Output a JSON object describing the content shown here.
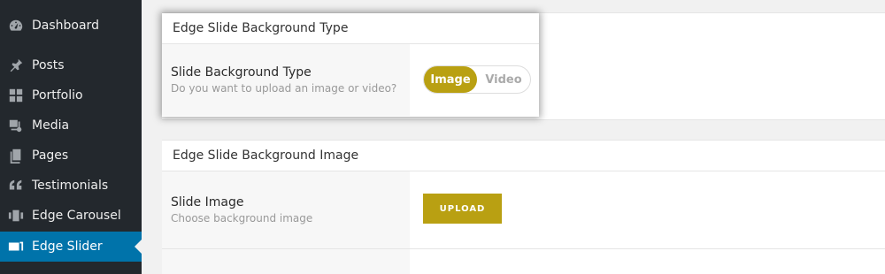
{
  "sidebar": {
    "items": [
      {
        "label": "Dashboard",
        "icon": "dashboard-icon"
      },
      {
        "label": "Posts",
        "icon": "pin-icon"
      },
      {
        "label": "Portfolio",
        "icon": "grid-icon"
      },
      {
        "label": "Media",
        "icon": "media-icon"
      },
      {
        "label": "Pages",
        "icon": "pages-icon"
      },
      {
        "label": "Testimonials",
        "icon": "quote-icon"
      },
      {
        "label": "Edge Carousel",
        "icon": "carousel-icon"
      },
      {
        "label": "Edge Slider",
        "icon": "slider-icon",
        "active": true
      }
    ]
  },
  "panel1": {
    "title": "Edge Slide Background Type",
    "row": {
      "label": "Slide Background Type",
      "description": "Do you want to upload an image or video?",
      "options": [
        "Image",
        "Video"
      ],
      "selected": "Image"
    }
  },
  "panel2": {
    "title": "Edge Slide Background Image",
    "row": {
      "label": "Slide Image",
      "description": "Choose background image",
      "button": "UPLOAD"
    }
  },
  "colors": {
    "accent": "#b9a012",
    "sidebar_bg": "#23282d",
    "sidebar_active": "#0073aa"
  }
}
